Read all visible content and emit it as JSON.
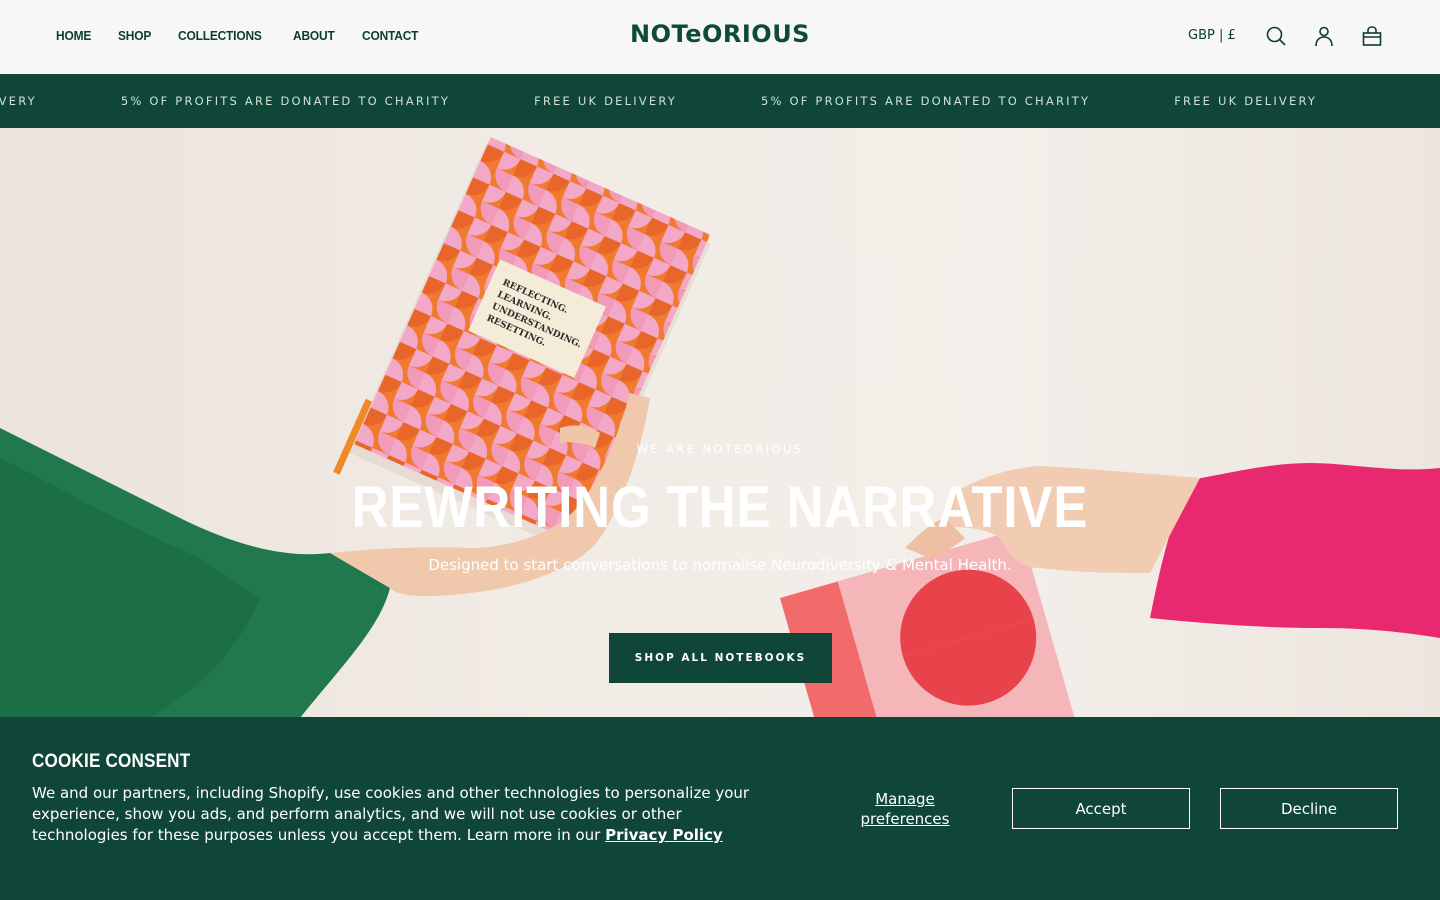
{
  "header": {
    "nav": [
      "HOME",
      "SHOP",
      "COLLECTIONS",
      "ABOUT",
      "CONTACT"
    ],
    "logo": "NOTeORIOUS",
    "currency": "GBP | £",
    "icons": [
      "search-icon",
      "account-icon",
      "cart-icon"
    ]
  },
  "marquee": {
    "items": [
      "ELIVERY",
      "5% OF PROFITS ARE DONATED TO CHARITY",
      "FREE UK DELIVERY",
      "5% OF PROFITS ARE DONATED TO CHARITY",
      "FREE UK DELIVERY"
    ]
  },
  "hero": {
    "book_text": "REFLECTING. LEARNING. UNDERSTANDING. RESETTING.",
    "eyebrow": "WE ARE NOTEORIOUS",
    "title": "REWRITING THE NARRATIVE",
    "subtitle": "Designed to start conversations to normalise Neurodiversity & Mental Health.",
    "cta": "SHOP ALL NOTEBOOKS"
  },
  "cookie": {
    "title": "COOKIE CONSENT",
    "body": "We and our partners, including Shopify, use cookies and other technologies to personalize your experience, show you ads, and perform analytics, and we will not use cookies or other technologies for these purposes unless you accept them. Learn more in our",
    "privacy_link": "Privacy Policy",
    "manage": "Manage preferences",
    "accept": "Accept",
    "decline": "Decline"
  },
  "colors": {
    "brand_green": "#0f4638",
    "text_dark": "#0e3b33",
    "header_bg": "#f7f7f7"
  }
}
